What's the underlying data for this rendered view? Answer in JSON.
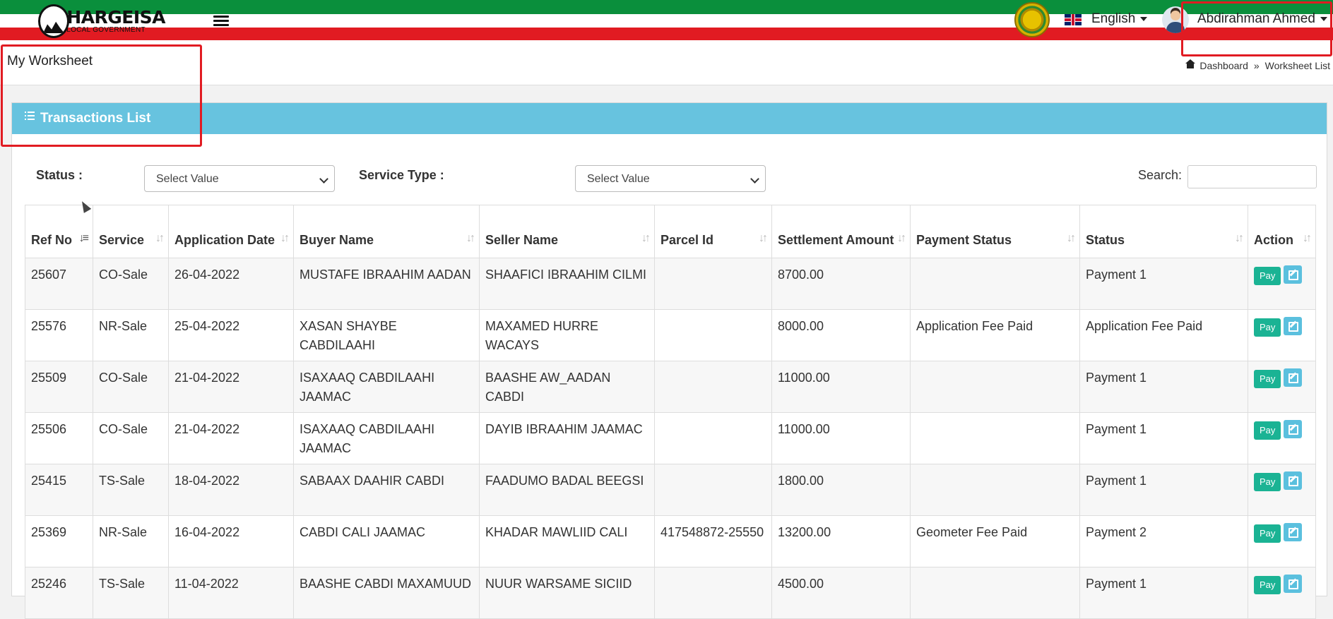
{
  "header": {
    "logo_title": "HARGEISA",
    "logo_subtitle": "LOCAL GOVERNMENT",
    "language": "English",
    "user_name": "Abdirahman Ahmed"
  },
  "page": {
    "title": "My Worksheet",
    "breadcrumb": [
      "Dashboard",
      "Worksheet List"
    ],
    "breadcrumb_sep": "»"
  },
  "panel": {
    "title": "Transactions List"
  },
  "filters": {
    "status_label": "Status :",
    "status_value": "Select Value",
    "service_type_label": "Service Type :",
    "service_type_value": "Select Value",
    "search_label": "Search:"
  },
  "table": {
    "columns": [
      "Ref No",
      "Service",
      "Application Date",
      "Buyer Name",
      "Seller Name",
      "Parcel Id",
      "Settlement Amount",
      "Payment Status",
      "Status",
      "Action"
    ],
    "pay_label": "Pay",
    "rows": [
      {
        "ref": "25607",
        "service": "CO-Sale",
        "date": "26-04-2022",
        "buyer": "MUSTAFE IBRAAHIM AADAN",
        "seller": "SHAAFICI IBRAAHIM CILMI",
        "parcel": "",
        "amount": "8700.00",
        "payment_status": "",
        "status": "Payment 1"
      },
      {
        "ref": "25576",
        "service": "NR-Sale",
        "date": "25-04-2022",
        "buyer": "XASAN SHAYBE CABDILAAHI",
        "seller": "MAXAMED HURRE WACAYS",
        "parcel": "",
        "amount": "8000.00",
        "payment_status": "Application Fee Paid",
        "status": "Application Fee Paid"
      },
      {
        "ref": "25509",
        "service": "CO-Sale",
        "date": "21-04-2022",
        "buyer": "ISAXAAQ CABDILAAHI JAAMAC",
        "seller": "BAASHE AW_AADAN CABDI",
        "parcel": "",
        "amount": "11000.00",
        "payment_status": "",
        "status": "Payment 1"
      },
      {
        "ref": "25506",
        "service": "CO-Sale",
        "date": "21-04-2022",
        "buyer": "ISAXAAQ CABDILAAHI JAAMAC",
        "seller": "DAYIB IBRAAHIM JAAMAC",
        "parcel": "",
        "amount": "11000.00",
        "payment_status": "",
        "status": "Payment 1"
      },
      {
        "ref": "25415",
        "service": "TS-Sale",
        "date": "18-04-2022",
        "buyer": "SABAAX DAAHIR CABDI",
        "seller": "FAADUMO BADAL BEEGSI",
        "parcel": "",
        "amount": "1800.00",
        "payment_status": "",
        "status": "Payment 1"
      },
      {
        "ref": "25369",
        "service": "NR-Sale",
        "date": "16-04-2022",
        "buyer": "CABDI CALI JAAMAC",
        "seller": "KHADAR MAWLIID CALI",
        "parcel": "417548872-25550",
        "amount": "13200.00",
        "payment_status": "Geometer Fee Paid",
        "status": "Payment 2"
      },
      {
        "ref": "25246",
        "service": "TS-Sale",
        "date": "11-04-2022",
        "buyer": "BAASHE CABDI MAXAMUUD",
        "seller": "NUUR WARSAME SICIID",
        "parcel": "",
        "amount": "4500.00",
        "payment_status": "",
        "status": "Payment 1"
      }
    ]
  },
  "colors": {
    "green_stripe": "#0a8f3c",
    "red_stripe": "#e11b22",
    "panel_header": "#67c3df",
    "pay_button": "#1bb394",
    "edit_button": "#5bc0de",
    "highlight_box": "#e11b22"
  }
}
